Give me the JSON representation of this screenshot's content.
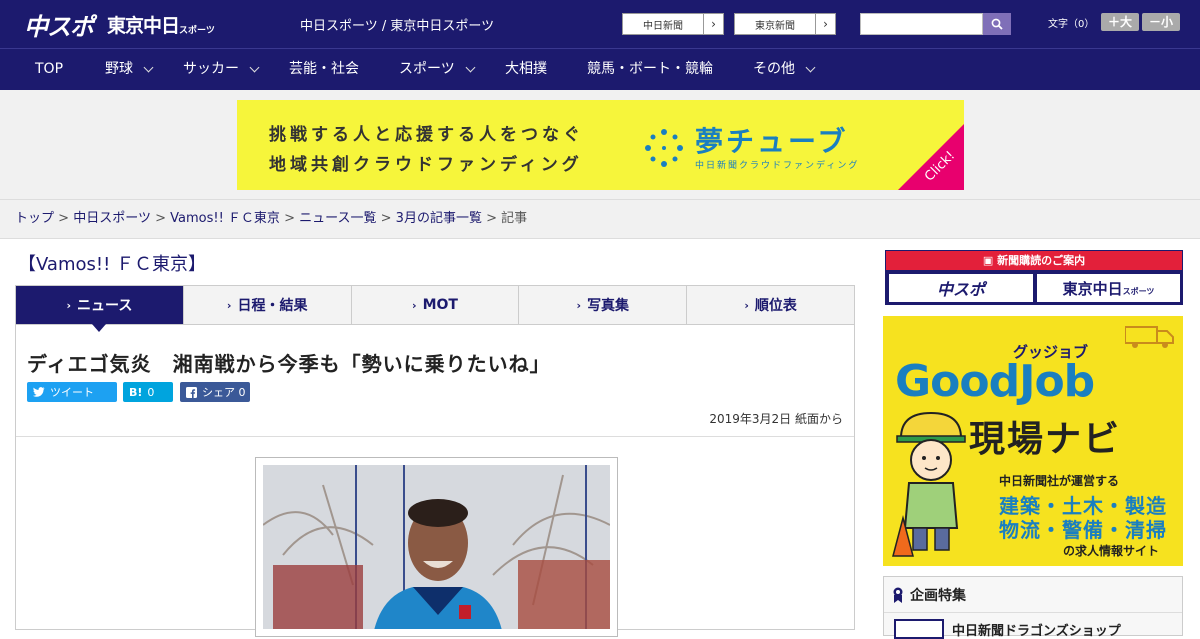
{
  "header": {
    "logo_main": "中スポ",
    "logo_second": "東京中日",
    "logo_second_small": "スポーツ",
    "site_name": "中日スポーツ / 東京中日スポーツ",
    "site_button_1": "中日新聞",
    "site_button_2": "東京新聞",
    "search_placeholder": "",
    "font_size_label": "文字（0）",
    "font_bigger": "＋大",
    "font_smaller": "－小"
  },
  "nav": {
    "items": [
      {
        "label": "TOP",
        "has_menu": false
      },
      {
        "label": "野球",
        "has_menu": true
      },
      {
        "label": "サッカー",
        "has_menu": true
      },
      {
        "label": "芸能・社会",
        "has_menu": false
      },
      {
        "label": "スポーツ",
        "has_menu": true
      },
      {
        "label": "大相撲",
        "has_menu": false
      },
      {
        "label": "競馬・ボート・競輪",
        "has_menu": false
      },
      {
        "label": "その他",
        "has_menu": true
      }
    ]
  },
  "banner": {
    "line1": "挑戦する人と応援する人をつなぐ",
    "line2": "地域共創クラウドファンディング",
    "brand": "夢チューブ",
    "brand_sub": "中日新聞クラウドファンディング",
    "cta": "Click!"
  },
  "breadcrumb": {
    "items": [
      "トップ",
      "中日スポーツ",
      "Vamos!! ＦＣ東京",
      "ニュース一覧",
      "3月の記事一覧"
    ],
    "current": "記事",
    "separator": ">"
  },
  "section_title": "【Vamos!! ＦＣ東京】",
  "tabs": [
    {
      "label": "ニュース",
      "active": true
    },
    {
      "label": "日程・結果",
      "active": false
    },
    {
      "label": "MOT",
      "active": false
    },
    {
      "label": "写真集",
      "active": false
    },
    {
      "label": "順位表",
      "active": false
    }
  ],
  "article": {
    "headline": "ディエゴ気炎　湘南戦から今季も「勢いに乗りたいね」",
    "share": {
      "tweet": "ツイート",
      "hatena_icon": "B!",
      "hatena_count": "0",
      "facebook": "シェア",
      "facebook_count": "0"
    },
    "date": "2019年3月2日 紙面から"
  },
  "sidebar": {
    "subscribe_header": "新聞購読のご案内",
    "subscribe_1": "中スポ",
    "subscribe_2": "東京中日",
    "subscribe_2_small": "スポーツ",
    "goodjob_tag": "グッジョブ",
    "goodjob_title": "GoodJob",
    "goodjob_sub": "現場ナビ",
    "goodjob_line1": "中日新聞社が運営する",
    "goodjob_line2": "建築・土木・製造",
    "goodjob_line3": "物流・警備・清掃",
    "goodjob_line4": "の求人情報サイト",
    "feature_title": "企画特集",
    "feature_item": "中日新聞ドラゴンズショップ"
  },
  "colors": {
    "brand_navy": "#1c1a6e",
    "banner_yellow": "#f6f53b",
    "accent_red": "#e3203a",
    "twitter": "#1da1f2",
    "hatena": "#00a4de",
    "facebook": "#3b5998"
  }
}
